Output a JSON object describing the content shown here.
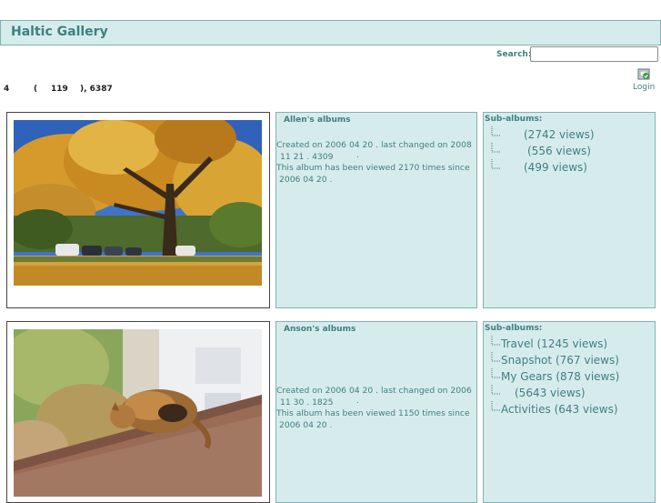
{
  "site": {
    "title": "Haltic Gallery"
  },
  "search": {
    "label": "Search:",
    "value": "",
    "placeholder": ""
  },
  "login": {
    "label": "Login",
    "icon": "login-icon"
  },
  "stats": {
    "p1": "4",
    "p2": "(",
    "p3": "119",
    "p4": "), 6387"
  },
  "colors": {
    "accent": "#3f7f7f",
    "panel_bg": "#d6ecec",
    "panel_border": "#7fb2b2"
  },
  "albums": [
    {
      "title": "Allen's albums",
      "created_line1": "Created on   2006 04 20 . last changed on   2008",
      "created_line2": "11 21 . 4309",
      "created_line3": ".",
      "viewed_line1": "This album has been viewed 2170 times since",
      "viewed_line2": "2006 04 20 .",
      "subalbums_label": "Sub-albums:",
      "subalbums": [
        {
          "name": "",
          "views": "(2742 views)"
        },
        {
          "name": "",
          "views": "(556 views)"
        },
        {
          "name": "",
          "views": "(499 views)"
        }
      ]
    },
    {
      "title": "Anson's albums",
      "created_line1": "Created on   2006 04 20 . last changed on   2006",
      "created_line2": "11 30 . 1825",
      "created_line3": ".",
      "viewed_line1": "This album has been viewed 1150 times since",
      "viewed_line2": "2006 04 20 .",
      "subalbums_label": "Sub-albums:",
      "subalbums": [
        {
          "name": "Travel",
          "views": "(1245 views)"
        },
        {
          "name": "Snapshot",
          "views": "(767 views)"
        },
        {
          "name": "My Gears",
          "views": "(878 views)"
        },
        {
          "name": "",
          "views": "(5643 views)"
        },
        {
          "name": "Activities",
          "views": "(643 views)"
        }
      ]
    }
  ]
}
